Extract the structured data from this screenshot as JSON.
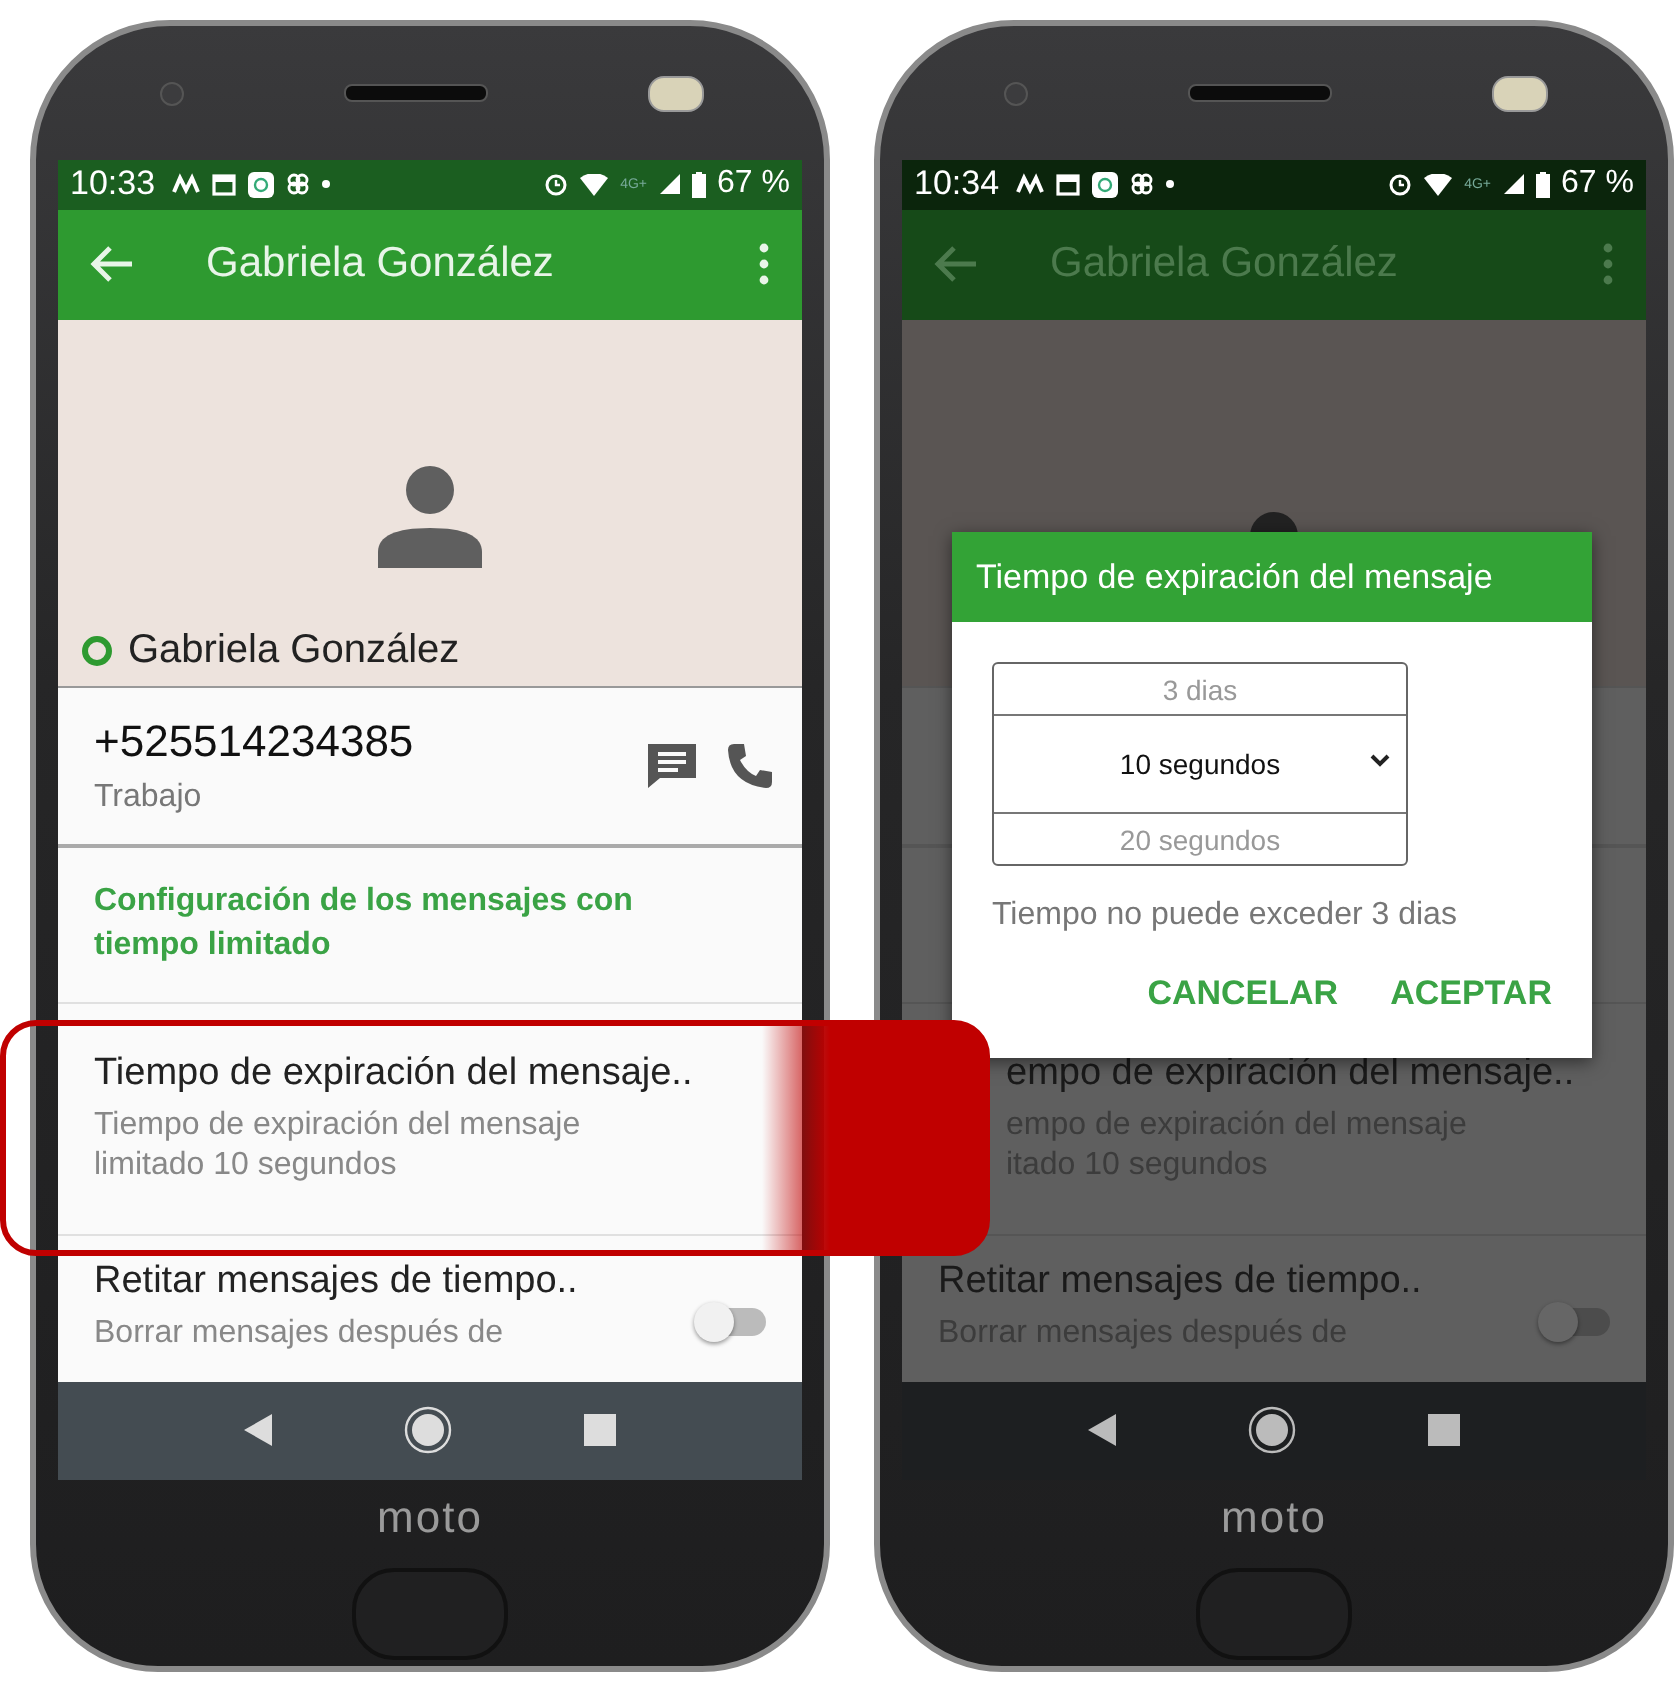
{
  "phones": [
    {
      "dimmed": false,
      "status_bar": {
        "time": "10:33",
        "network": "4G+",
        "battery": "67 %"
      },
      "app_bar": {
        "title": "Gabriela González"
      },
      "contact": {
        "name": "Gabriela González",
        "phone": "+525514234385",
        "phone_type": "Trabajo"
      },
      "section_header": "Configuración de los mensajes con tiempo limitado",
      "settings": [
        {
          "kind": "text",
          "title": "Tiempo de expiración del mensaje..",
          "summary_lines": [
            "Tiempo de expiración del mensaje",
            "limitado 10 segundos"
          ]
        },
        {
          "kind": "switch",
          "on": false,
          "title": "Retitar mensajes de tiempo..",
          "summary_lines": [
            "Borrar mensajes después de"
          ]
        }
      ],
      "brand": "moto"
    },
    {
      "dimmed": true,
      "status_bar": {
        "time": "10:34",
        "network": "4G+",
        "battery": "67 %"
      },
      "app_bar": {
        "title": "Gabriela González"
      },
      "settings": [
        {
          "kind": "text",
          "partly_covered": true,
          "title": "empo de expiración del mensaje..",
          "summary_lines": [
            "empo de expiración del mensaje",
            "itado 10 segundos"
          ]
        },
        {
          "kind": "switch",
          "on": false,
          "title": "Retitar mensajes de tiempo..",
          "summary_lines": [
            "Borrar mensajes después de"
          ]
        }
      ],
      "dialog": {
        "title": "Tiempo de expiración del mensaje",
        "picker": [
          {
            "label": "3 dias",
            "selected": false
          },
          {
            "label": "10 segundos",
            "selected": true
          },
          {
            "label": "20 segundos",
            "selected": false
          }
        ],
        "note": "Tiempo no puede exceder 3 dias",
        "buttons": [
          "CANCELAR",
          "ACEPTAR"
        ]
      },
      "brand": "moto"
    }
  ]
}
